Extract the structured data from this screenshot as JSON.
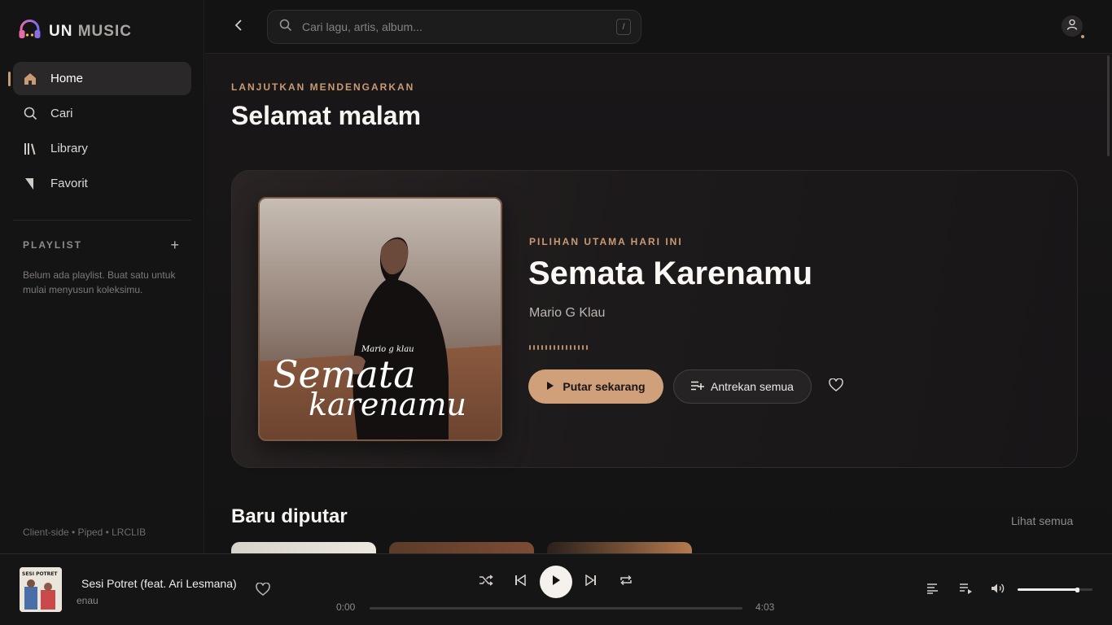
{
  "colors": {
    "accent": "#c99a74",
    "background": "#121112",
    "panel": "#151415"
  },
  "brand": {
    "logo_un": "UN",
    "logo_music": "MUSIC",
    "icon": "headphones-icon"
  },
  "sidebar": {
    "nav": [
      {
        "label": "Home",
        "icon": "home-icon",
        "active": true
      },
      {
        "label": "Cari",
        "icon": "search-icon",
        "active": false
      },
      {
        "label": "Library",
        "icon": "library-icon",
        "active": false
      },
      {
        "label": "Favorit",
        "icon": "favorite-icon",
        "active": false
      }
    ],
    "playlist_title": "PLAYLIST",
    "playlist_add": "+",
    "playlist_empty": "Belum ada playlist. Buat satu untuk mulai menyusun koleksimu.",
    "footer": "Client-side • Piped • LRCLIB"
  },
  "topbar": {
    "search_placeholder": "Cari lagu, artis, album...",
    "search_shortcut": "/"
  },
  "main": {
    "eyebrow": "LANJUTKAN MENDENGARKAN",
    "greeting": "Selamat malam",
    "hero": {
      "eyebrow": "PILIHAN UTAMA HARI INI",
      "title": "Semata Karenamu",
      "artist": "Mario G Klau",
      "cover_script_small": "Mario g klau",
      "cover_script_line1": "Semata",
      "cover_script_line2": "karenamu",
      "play_label": "Putar sekarang",
      "queue_label": "Antrekan semua"
    },
    "recent": {
      "title": "Baru diputar",
      "see_all": "Lihat semua"
    }
  },
  "player": {
    "title": "Sesi Potret (feat. Ari Lesmana)",
    "artist": "enau",
    "cover_text": "SESI POTRET",
    "time_current": "0:00",
    "time_total": "4:03",
    "progress": 0,
    "volume": 0.8
  }
}
